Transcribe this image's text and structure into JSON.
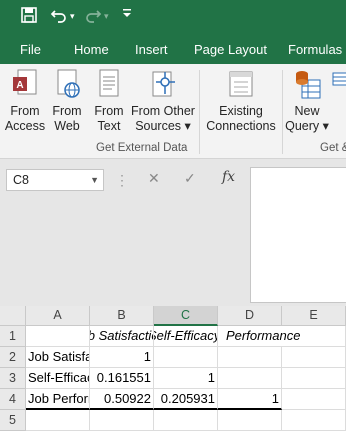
{
  "quick_access": {
    "save_icon": "save-icon",
    "undo_icon": "undo-icon",
    "redo_icon": "redo-icon",
    "customize_icon": "customize-icon"
  },
  "tabs": [
    "File",
    "Home",
    "Insert",
    "Page Layout",
    "Formulas"
  ],
  "ribbon": {
    "get_external_data": {
      "buttons": [
        {
          "line1": "From",
          "line2": "Access",
          "icon": "access-icon"
        },
        {
          "line1": "From",
          "line2": "Web",
          "icon": "web-icon"
        },
        {
          "line1": "From",
          "line2": "Text",
          "icon": "text-file-icon"
        },
        {
          "line1": "From Other",
          "line2": "Sources ▾",
          "icon": "other-sources-icon"
        },
        {
          "line1": "Existing",
          "line2": "Connections",
          "icon": "connections-icon"
        }
      ],
      "label": "Get External Data"
    },
    "get_transform": {
      "buttons": [
        {
          "line1": "New",
          "line2": "Query ▾",
          "icon": "new-query-icon"
        }
      ],
      "label": "Get &"
    }
  },
  "formula_bar": {
    "name_box": "C8",
    "cancel": "✕",
    "enter": "✓",
    "fx": "fx",
    "value": ""
  },
  "columns": [
    "A",
    "B",
    "C",
    "D",
    "E"
  ],
  "selected_column": "C",
  "rows": [
    "1",
    "2",
    "3",
    "4",
    "5"
  ],
  "cells": {
    "B1": "Job Satisfaction",
    "C1": "Self-Efficacy",
    "D1": "Performance",
    "A2": "Job Satisfaction",
    "B2": "1",
    "A3": "Self-Efficacy",
    "B3": "0.161551",
    "C3": "1",
    "A4": "Job Performance",
    "B4": "0.50922",
    "C4": "0.205931",
    "D4": "1"
  },
  "colors": {
    "accent": "#217346",
    "ribbon_bg": "#f3f3f3",
    "grid_header": "#e9e9e9"
  }
}
